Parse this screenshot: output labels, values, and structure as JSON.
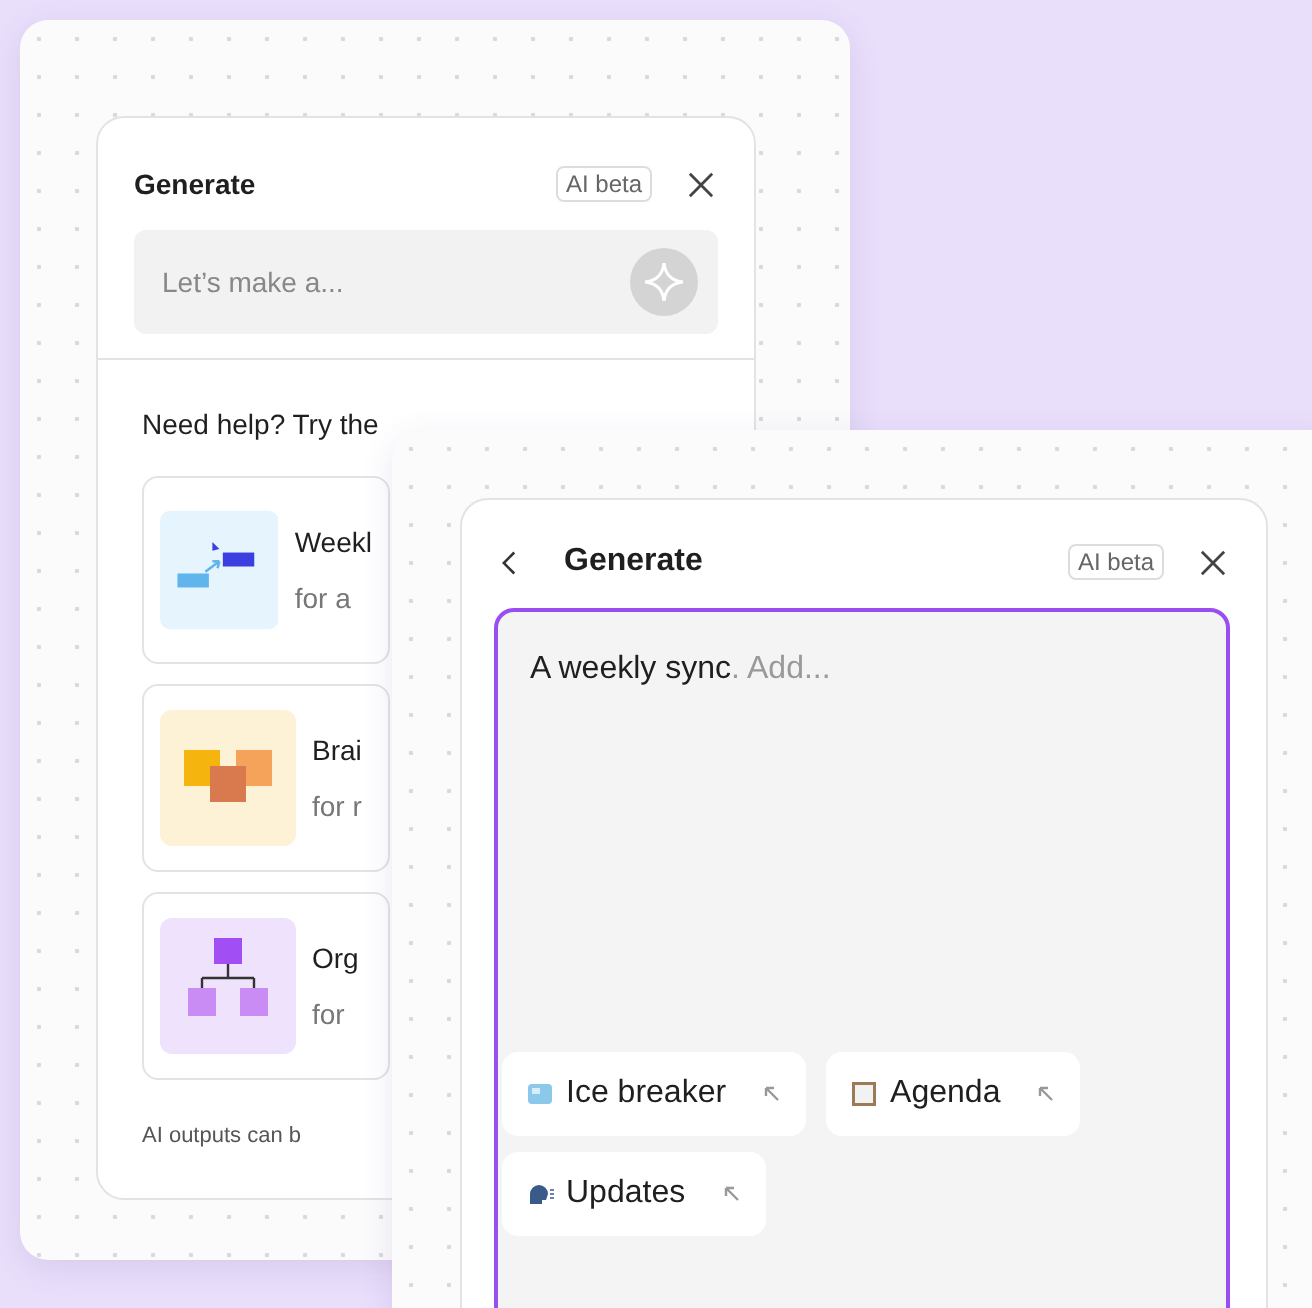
{
  "back_panel": {
    "title": "Generate",
    "badge": "AI beta",
    "prompt": {
      "placeholder": "Let’s make a..."
    },
    "help_heading": "Need help? Try the",
    "templates": [
      {
        "kind": "flow",
        "title": "Weekl",
        "subtitle": "for a"
      },
      {
        "kind": "sticky",
        "title": "Brai",
        "subtitle": "for r"
      },
      {
        "kind": "org",
        "title": "Org",
        "subtitle": "for"
      }
    ],
    "footer": "AI outputs can b"
  },
  "front_panel": {
    "title": "Generate",
    "badge": "AI beta",
    "prompt": {
      "value": "A weekly sync",
      "placeholder": ". Add..."
    },
    "suggestions": [
      {
        "kind": "ice",
        "label": "Ice breaker"
      },
      {
        "kind": "agenda",
        "label": "Agenda"
      },
      {
        "kind": "updates",
        "label": "Updates"
      }
    ]
  }
}
